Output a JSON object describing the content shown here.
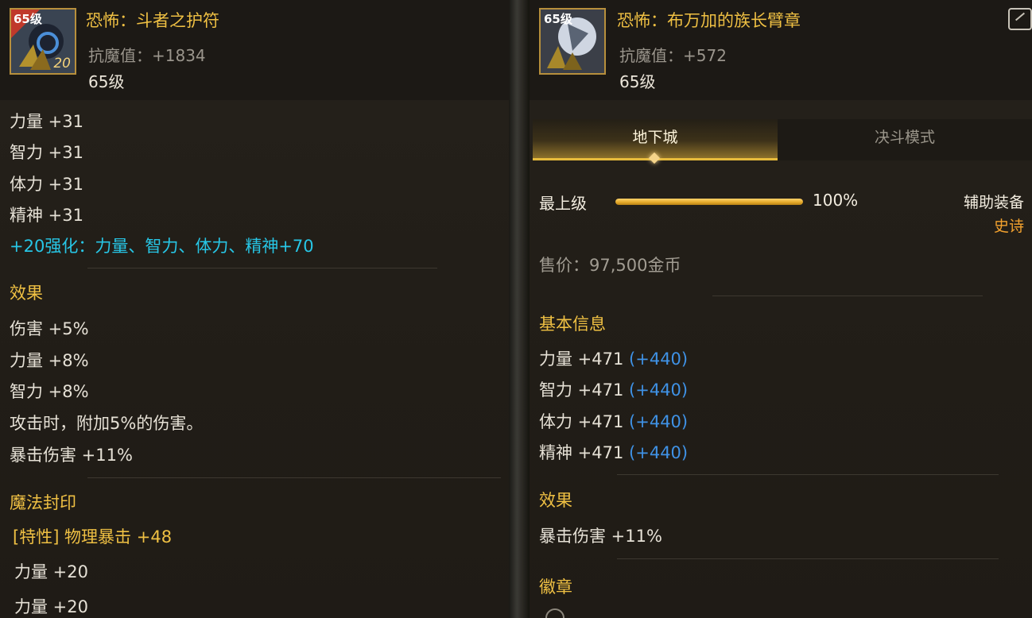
{
  "left": {
    "item_name": "恐怖：斗者之护符",
    "defense": "抗魔值：+1834",
    "level": "65级",
    "icon_level": "65级",
    "icon_enhance": "20",
    "icon_name": "amulet-icon",
    "base_stats": [
      "力量 +31",
      "智力 +31",
      "体力 +31",
      "精神 +31"
    ],
    "enhance_line": "+20强化：力量、智力、体力、精神+70",
    "effect_title": "效果",
    "effects": [
      "伤害 +5%",
      "力量 +8%",
      "智力 +8%",
      "攻击时，附加5%的伤害。",
      "暴击伤害 +11%"
    ],
    "seal_title": "魔法封印",
    "seal_trait": "[特性] 物理暴击 +48",
    "seal_lines": [
      "力量 +20",
      "力量 +20"
    ]
  },
  "right": {
    "item_name": "恐怖：布万加的族长臂章",
    "defense": "抗魔值：+572",
    "level": "65级",
    "icon_level": "65级",
    "icon_name": "armband-icon",
    "tabs": [
      {
        "label": "地下城",
        "active": true
      },
      {
        "label": "决斗模式",
        "active": false
      }
    ],
    "grade_label": "最上级",
    "grade_progress": 1.0,
    "grade_percent": "100%",
    "item_type": "辅助装备",
    "rarity": "史诗",
    "price": "售价：97,500金币",
    "basic_info_title": "基本信息",
    "stats": [
      {
        "text": "力量 +471",
        "bonus": "(+440)"
      },
      {
        "text": "智力 +471",
        "bonus": "(+440)"
      },
      {
        "text": "体力 +471",
        "bonus": "(+440)"
      },
      {
        "text": "精神 +471",
        "bonus": "(+440)"
      }
    ],
    "effect_title": "效果",
    "effects": [
      "暴击伤害 +11%"
    ],
    "emblem_title": "徽章"
  },
  "colors": {
    "gold": "#efc043",
    "cyan": "#27c6e6",
    "blue": "#3f92e6",
    "rarity": "#f2a12e"
  }
}
